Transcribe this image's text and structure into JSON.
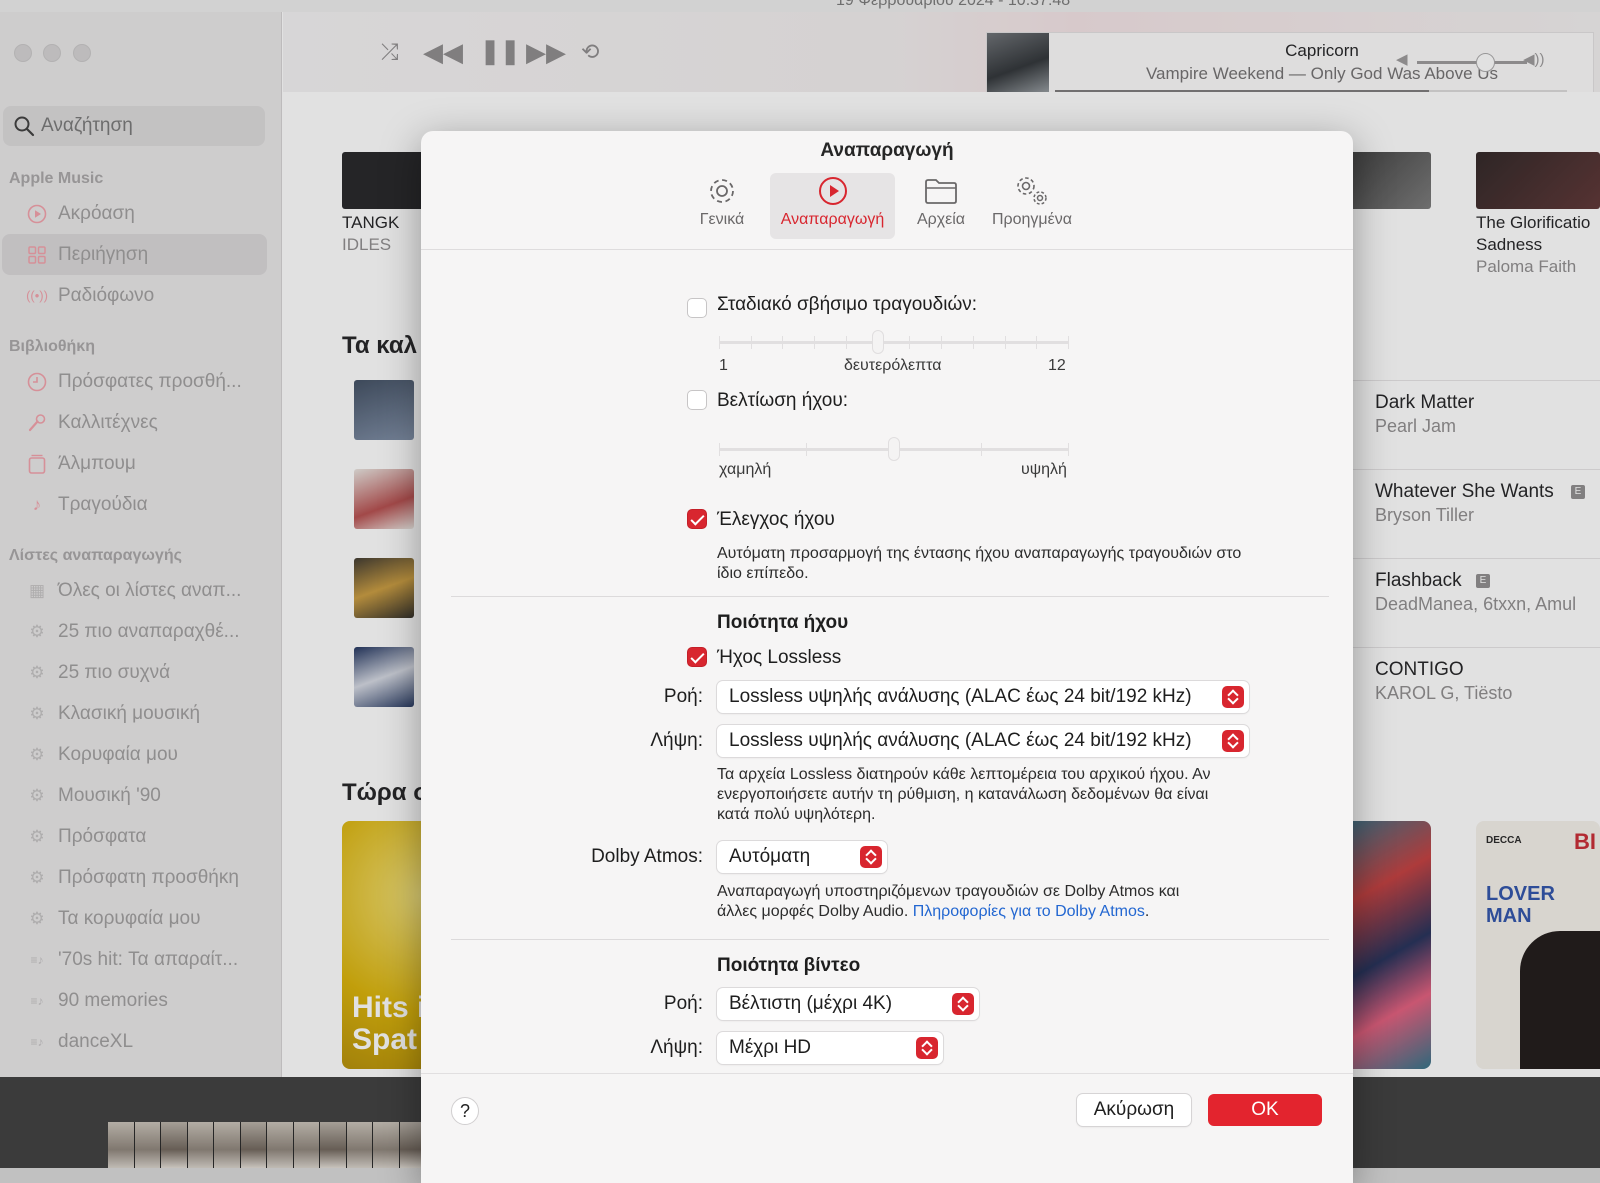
{
  "desktop": {
    "clock": "19 Φεβρουαρίου 2024 - 10:37:48"
  },
  "sidebar": {
    "search_placeholder": "Αναζήτηση",
    "sections": {
      "apple_music": "Apple Music",
      "library": "Βιβλιοθήκη",
      "playlists": "Λίστες αναπαραγωγής"
    },
    "apple_music_items": [
      {
        "label": "Ακρόαση",
        "icon": "play-circle-icon"
      },
      {
        "label": "Περιήγηση",
        "icon": "grid-icon",
        "selected": true
      },
      {
        "label": "Ραδιόφωνο",
        "icon": "radio-icon"
      }
    ],
    "library_items": [
      {
        "label": "Πρόσφατες προσθή...",
        "icon": "clock-icon"
      },
      {
        "label": "Καλλιτέχνες",
        "icon": "microphone-icon"
      },
      {
        "label": "Άλμπουμ",
        "icon": "album-icon"
      },
      {
        "label": "Τραγούδια",
        "icon": "music-note-icon"
      }
    ],
    "playlist_items": [
      {
        "label": "Όλες οι λίστες αναπ...",
        "icon": "grid-icon"
      },
      {
        "label": "25 πιο αναπαραχθέ...",
        "icon": "gear-icon"
      },
      {
        "label": "25 πιο συχνά",
        "icon": "gear-icon"
      },
      {
        "label": "Κλασική μουσική",
        "icon": "gear-icon"
      },
      {
        "label": "Κορυφαία μου",
        "icon": "gear-icon"
      },
      {
        "label": "Μουσική '90",
        "icon": "gear-icon"
      },
      {
        "label": "Πρόσφατα",
        "icon": "gear-icon"
      },
      {
        "label": "Πρόσφατη προσθήκη",
        "icon": "gear-icon"
      },
      {
        "label": "Τα κορυφαία μου",
        "icon": "gear-icon"
      },
      {
        "label": "'70s hit: Τα απαραίτ...",
        "icon": "playlist-icon"
      },
      {
        "label": "90 memories",
        "icon": "playlist-icon"
      },
      {
        "label": "danceXL",
        "icon": "playlist-icon"
      }
    ]
  },
  "player": {
    "now_playing_title": "Capricorn",
    "now_playing_subtitle": "Vampire Weekend — Only God Was Above Us",
    "progress": 0.73,
    "volume": 0.62
  },
  "browse": {
    "album_left": {
      "title": "TANGK",
      "artist": "IDLES"
    },
    "album_right": {
      "title": "The Glorificatio",
      "title_line2": "Sadness",
      "artist": "Paloma Faith"
    },
    "heading_1": "Τα καλ",
    "heading_2": "Τώρα σ",
    "promo_line1": "Hits i",
    "promo_line2": "Spat",
    "songs": [
      {
        "title": "Dark Matter",
        "artist": "Pearl Jam",
        "explicit": false
      },
      {
        "title": "Whatever She Wants",
        "artist": "Bryson Tiller",
        "explicit": true
      },
      {
        "title": "Flashback",
        "artist": "DeadManea, 6txxn, Amul",
        "explicit": true
      },
      {
        "title": "CONTIGO",
        "artist": "KAROL G, Tiësto",
        "explicit": false
      }
    ],
    "explicit_badge": "E",
    "cover_decca": "DECCA",
    "cover_lover_man": "LOVER MAN",
    "cover_bi": "BI"
  },
  "dialog": {
    "title": "Αναπαραγωγή",
    "tabs": [
      {
        "label": "Γενικά",
        "icon": "gear-icon"
      },
      {
        "label": "Αναπαραγωγή",
        "icon": "play-circle-icon",
        "active": true
      },
      {
        "label": "Αρχεία",
        "icon": "folder-icon"
      },
      {
        "label": "Προηγμένα",
        "icon": "gears-icon"
      }
    ],
    "crossfade": {
      "label": "Σταδιακό σβήσιμο τραγουδιών:",
      "checked": false,
      "min": "1",
      "unit": "δευτερόλεπτα",
      "max": "12",
      "value": 6
    },
    "sound_enhancer": {
      "label": "Βελτίωση ήχου:",
      "checked": false,
      "low": "χαμηλή",
      "high": "υψηλή",
      "level": 0.5
    },
    "sound_check": {
      "label": "Έλεγχος ήχου",
      "checked": true,
      "description_line1": "Αυτόματη προσαρμογή της έντασης ήχου αναπαραγωγής τραγουδιών στο",
      "description_line2": "ίδιο επίπεδο."
    },
    "audio_quality": {
      "heading": "Ποιότητα ήχου",
      "lossless_label": "Ήχος Lossless",
      "lossless_checked": true,
      "streaming_label": "Ροή:",
      "streaming_value": "Lossless υψηλής ανάλυσης (ALAC έως 24 bit/192 kHz)",
      "download_label": "Λήψη:",
      "download_value": "Lossless υψηλής ανάλυσης (ALAC έως 24 bit/192 kHz)",
      "note_line1": "Τα αρχεία Lossless διατηρούν κάθε λεπτομέρεια του αρχικού ήχου. Αν",
      "note_line2": "ενεργοποιήσετε αυτήν τη ρύθμιση, η κατανάλωση δεδομένων θα είναι",
      "note_line3": "κατά πολύ υψηλότερη.",
      "dolby_label": "Dolby Atmos:",
      "dolby_value": "Αυτόματη",
      "dolby_note_line1": "Αναπαραγωγή υποστηριζόμενων τραγουδιών σε Dolby Atmos και",
      "dolby_note_line2": "άλλες μορφές Dolby Audio.",
      "dolby_link": "Πληροφορίες για το Dolby Atmos"
    },
    "video_quality": {
      "heading": "Ποιότητα βίντεο",
      "streaming_label": "Ροή:",
      "streaming_value": "Βέλτιστη (μέχρι 4K)",
      "download_label": "Λήψη:",
      "download_value": "Μέχρι HD"
    },
    "help": "?",
    "cancel": "Ακύρωση",
    "ok": "OK",
    "accent_color": "#d8262f"
  }
}
